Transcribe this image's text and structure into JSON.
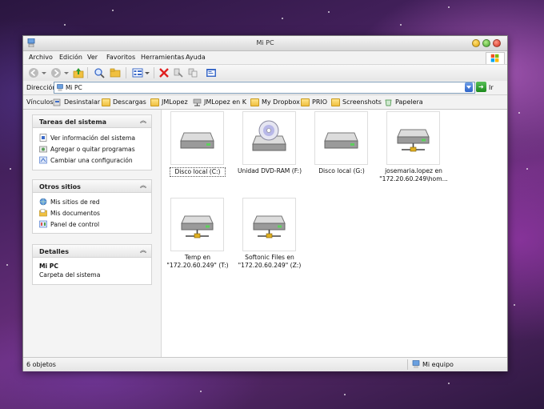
{
  "window": {
    "title": "Mi PC"
  },
  "menu": [
    "Archivo",
    "Edición",
    "Ver",
    "Favoritos",
    "Herramientas",
    "Ayuda"
  ],
  "address": {
    "label": "Dirección",
    "value": "Mi PC",
    "go_label": "Ir"
  },
  "links": {
    "label": "Vínculos",
    "items": [
      "Desinstalar",
      "Descargas",
      "JMLopez",
      "JMLopez en K",
      "My Dropbox",
      "PRIO",
      "Screenshots",
      "Papelera"
    ]
  },
  "tasks_panel": {
    "title": "Tareas del sistema",
    "items": [
      "Ver información del sistema",
      "Agregar o quitar programas",
      "Cambiar una configuración"
    ]
  },
  "places_panel": {
    "title": "Otros sitios",
    "items": [
      "Mis sitios de red",
      "Mis documentos",
      "Panel de control"
    ]
  },
  "details_panel": {
    "title": "Detalles",
    "name": "Mi PC",
    "desc": "Carpeta del sistema"
  },
  "drives": [
    {
      "label": "Disco local (C:)",
      "icon": "hard-drive-icon",
      "selected": true
    },
    {
      "label": "Unidad DVD-RAM (F:)",
      "icon": "dvd-drive-icon"
    },
    {
      "label": "Disco local (G:)",
      "icon": "hard-drive-icon"
    },
    {
      "label": "josemaria.lopez en \"172.20.60.249\\hom...",
      "icon": "network-drive-icon"
    },
    {
      "label": "Temp en \"172.20.60.249\" (T:)",
      "icon": "network-drive-icon"
    },
    {
      "label": "Softonic Files en \"172.20.60.249\" (Z:)",
      "icon": "network-drive-icon"
    }
  ],
  "status": {
    "count": "6 objetos",
    "location": "Mi equipo"
  }
}
